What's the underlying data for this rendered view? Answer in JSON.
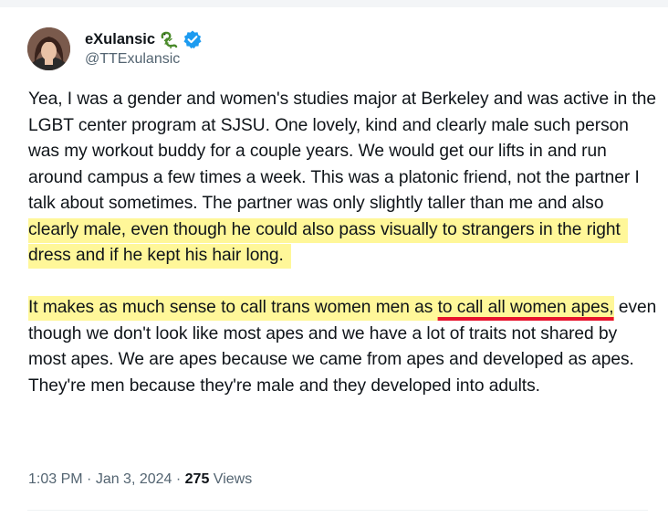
{
  "author": {
    "display_name": "eXulansic",
    "handle": "@TTExulansic",
    "badge_icon": "lizard-icon",
    "verified_icon": "verified-badge-icon",
    "verified_color": "#1d9bf0"
  },
  "tweet": {
    "p1_a": "Yea, I was a gender and women's studies major at Berkeley and was active in the LGBT center program at SJSU. One lovely, kind and clearly male such person was my workout buddy for a couple years. We would get our lifts in and run around campus a few times a week.  This was a platonic friend, not the partner I talk about sometimes. The partner was only slightly taller than me and also ",
    "p1_highlight": "clearly male, even though he could also pass visually to strangers in the right dress and if he kept his hair long.",
    "p2_highlight_a": "It makes as much sense to call trans women men as ",
    "p2_highlight_underlined": "to call all women apes,",
    "p2_rest": " even though we don't look like most apes and we have a lot of traits not shared by most apes. We are apes because we came from apes and developed as apes. They're men because they're male and they developed into adults."
  },
  "meta": {
    "time": "1:03 PM",
    "sep1": " · ",
    "date": "Jan 3, 2024",
    "sep2": " · ",
    "views_count": "275",
    "views_label": " Views"
  },
  "colors": {
    "highlight": "#fff799",
    "underline": "#e8132d",
    "secondary_text": "#536471"
  }
}
